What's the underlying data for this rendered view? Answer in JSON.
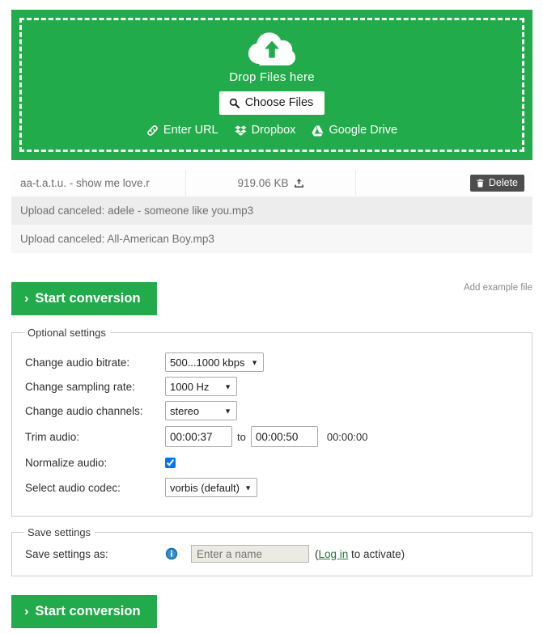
{
  "theme": {
    "green": "#22ab4b",
    "delete_gray": "#4d4d4d",
    "link_green": "#1f7a3a"
  },
  "dropzone": {
    "icon": "cloud-upload-icon",
    "drop_label": "Drop Files here",
    "choose_files_label": "Choose Files",
    "choose_files_icon": "search-icon",
    "sources": [
      {
        "label": "Enter URL",
        "icon": "link-icon"
      },
      {
        "label": "Dropbox",
        "icon": "dropbox-icon"
      },
      {
        "label": "Google Drive",
        "icon": "google-drive-icon"
      }
    ]
  },
  "filelist": {
    "rows": [
      {
        "name": "aa-t.a.t.u. - show me love.r",
        "size": "919.06 KB",
        "size_icon": "upload-icon",
        "delete_label": "Delete",
        "delete_icon": "trash-icon"
      }
    ],
    "canceled": [
      "Upload canceled: adele - someone like you.mp3",
      "Upload canceled: All-American Boy.mp3"
    ]
  },
  "actions": {
    "start_conversion_label": "Start conversion",
    "start_chevron": "›",
    "add_example_file_label": "Add example file"
  },
  "optional_settings": {
    "legend": "Optional settings",
    "fields": {
      "bitrate": {
        "label": "Change audio bitrate:",
        "value": "500...1000 kbps",
        "options": [
          "500...1000 kbps"
        ]
      },
      "sampling": {
        "label": "Change sampling rate:",
        "value": "1000 Hz",
        "options": [
          "1000 Hz"
        ]
      },
      "channels": {
        "label": "Change audio channels:",
        "value": "stereo",
        "options": [
          "stereo"
        ]
      },
      "trim": {
        "label": "Trim audio:",
        "start_value": "00:00:37",
        "end_value": "00:00:50",
        "separator": "to",
        "duration": "00:00:00"
      },
      "normalize": {
        "label": "Normalize audio:",
        "checked": true
      },
      "codec": {
        "label": "Select audio codec:",
        "value": "vorbis (default)",
        "options": [
          "vorbis (default)"
        ]
      }
    }
  },
  "save_settings": {
    "legend": "Save settings",
    "label": "Save settings as:",
    "info_icon": "info-icon",
    "name_placeholder": "Enter a name",
    "name_value": "",
    "activate_prefix": "(",
    "login_link": "Log in",
    "activate_suffix": " to activate)"
  }
}
